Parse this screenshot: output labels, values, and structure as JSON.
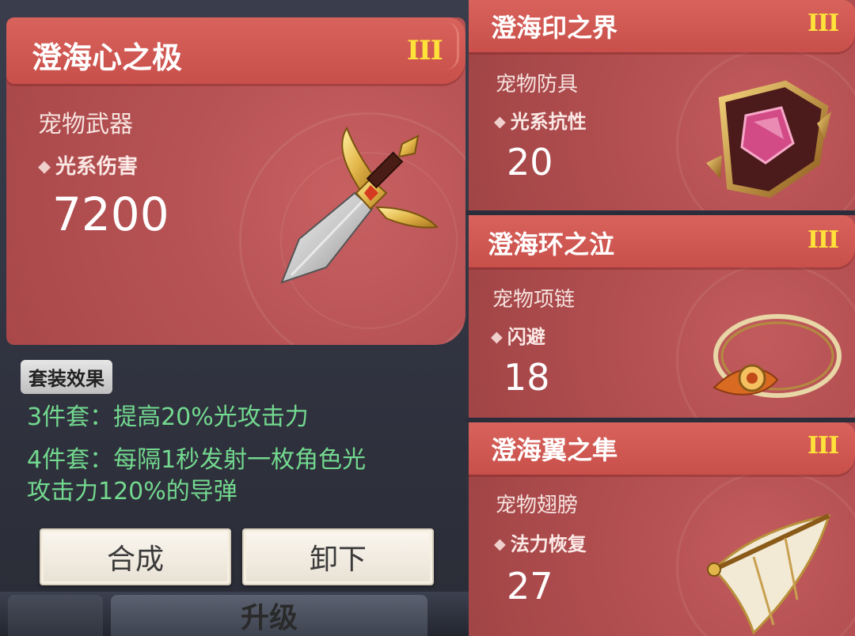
{
  "main_item": {
    "name": "澄海心之极",
    "tier": "III",
    "type": "宠物武器",
    "stat_name": "光系伤害",
    "stat_value": "7200"
  },
  "set_effect": {
    "badge": "套装效果",
    "line1": "3件套：提高20%光攻击力",
    "line2a": "4件套：每隔1秒发射一枚角色光",
    "line2b": "攻击力120%的导弹"
  },
  "buttons": {
    "synthesize": "合成",
    "unequip": "卸下",
    "upgrade": "升级"
  },
  "side_items": [
    {
      "name": "澄海印之界",
      "tier": "III",
      "type": "宠物防具",
      "stat_name": "光系抗性",
      "stat_value": "20"
    },
    {
      "name": "澄海环之泣",
      "tier": "III",
      "type": "宠物项链",
      "stat_name": "闪避",
      "stat_value": "18"
    },
    {
      "name": "澄海翼之隼",
      "tier": "III",
      "type": "宠物翅膀",
      "stat_name": "法力恢复",
      "stat_value": "27"
    }
  ],
  "icons": {
    "main": "sword-icon",
    "side": [
      "armor-gem-icon",
      "ring-necklace-icon",
      "wing-icon"
    ]
  },
  "colors": {
    "card_red": "#b65254",
    "header_red": "#d8625c",
    "tier_yellow": "#ffe23a",
    "set_green": "#73d98f"
  }
}
